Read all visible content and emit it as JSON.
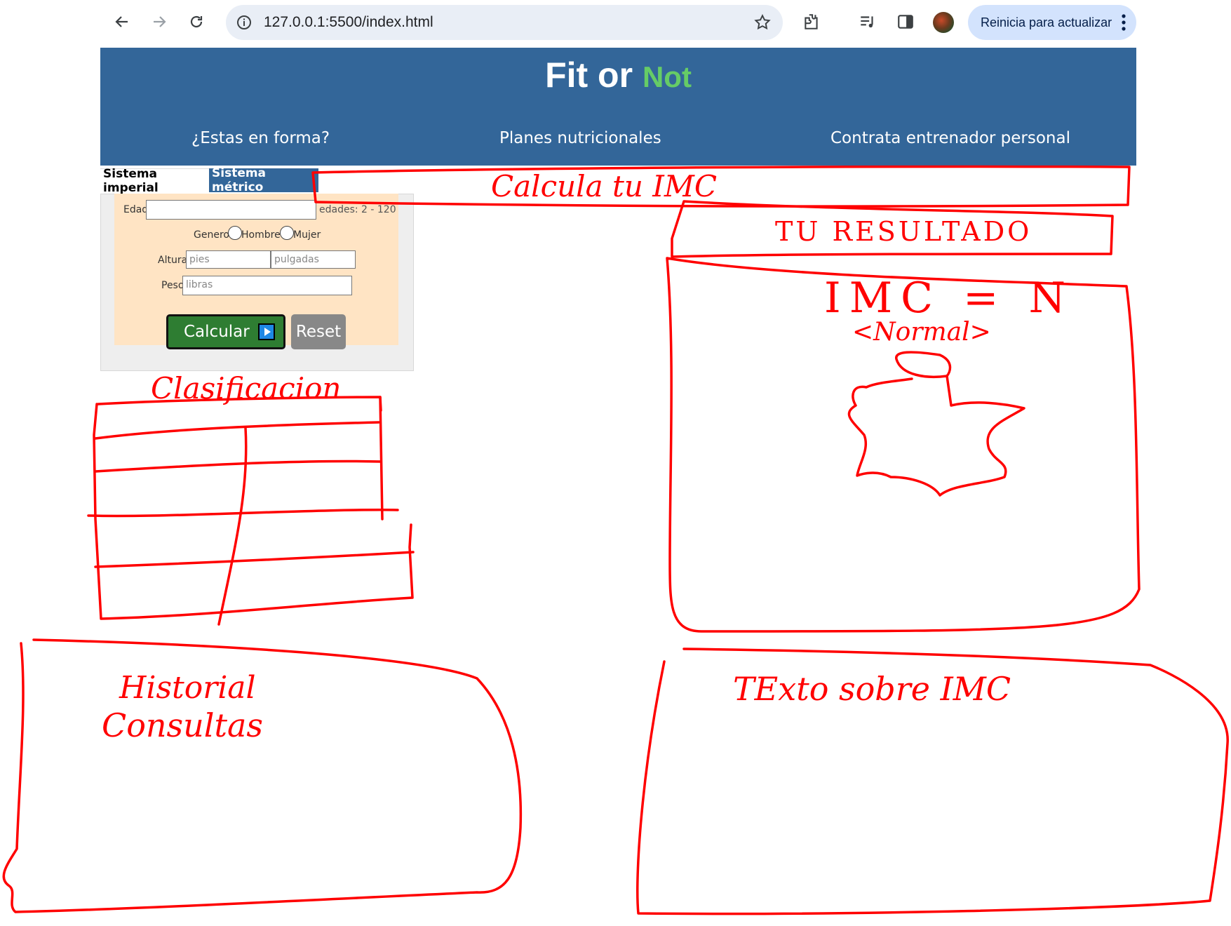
{
  "browser": {
    "url": "127.0.0.1:5500/index.html",
    "update_label": "Reinicia para actualizar"
  },
  "site": {
    "logo_main": "Fit or",
    "logo_accent": "Not",
    "menu": [
      "¿Estas en forma?",
      "Planes nutricionales",
      "Contrata entrenador personal"
    ]
  },
  "tabs": [
    "Sistema imperial",
    "Sistema métrico"
  ],
  "form": {
    "age_label": "Edad",
    "age_hint": "edades: 2 - 120",
    "gender_label": "Genero",
    "gender_options": [
      "Hombre",
      "Mujer"
    ],
    "height_label": "Altura",
    "height_ft_placeholder": "pies",
    "height_in_placeholder": "pulgadas",
    "weight_label": "Peso",
    "weight_placeholder": "libras",
    "calculate_label": "Calcular",
    "reset_label": "Reset"
  },
  "sketch": {
    "calc_title": "Calcula tu IMC",
    "result_title": "TU RESULTADO",
    "result_formula": "IMC = N",
    "result_category": "<Normal>",
    "classification_title": "Clasificacion",
    "history_line1": "Historial",
    "history_line2": "Consultas",
    "bmi_text_title": "TExto sobre IMC",
    "ink_color": "#ff0000"
  }
}
